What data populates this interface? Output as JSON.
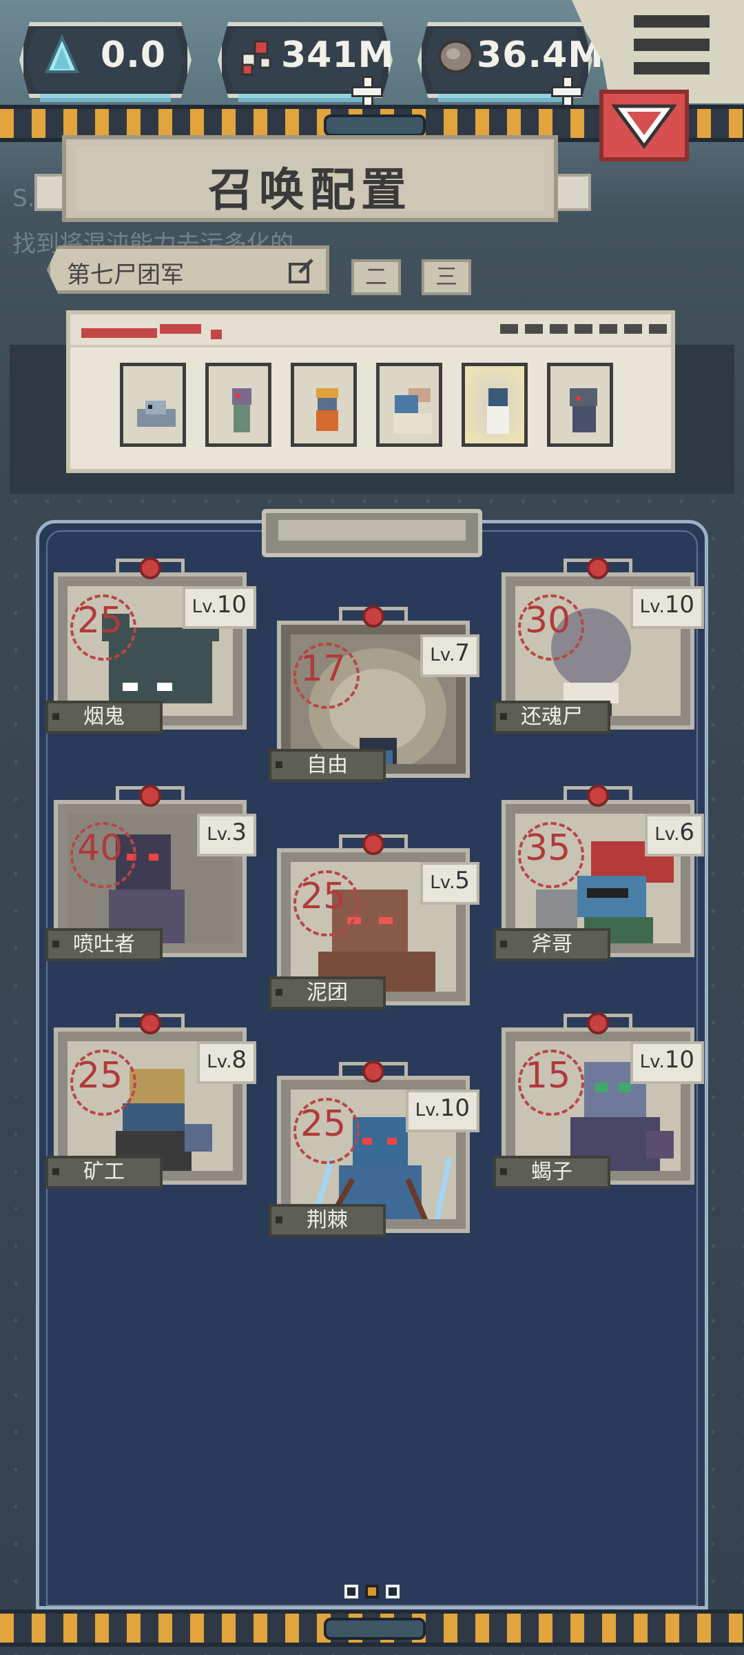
{
  "resources": [
    {
      "id": "crystal",
      "value": "0.0",
      "icon": "crystal-icon",
      "has_plus": false
    },
    {
      "id": "gems",
      "value": "341M",
      "icon": "blood-gem-icon",
      "has_plus": true
    },
    {
      "id": "skulls",
      "value": "36.4M",
      "icon": "skull-coin-icon",
      "has_plus": true
    }
  ],
  "header": {
    "title": "召唤配置",
    "bg_text_left": "S.O",
    "bg_text_hint": "找到将混沌能力去污多化的"
  },
  "squad": {
    "name": "第七尸团军",
    "tabs": [
      "二",
      "三"
    ]
  },
  "lineup": {
    "slots": [
      "slot-1",
      "slot-2",
      "slot-3",
      "slot-4",
      "slot-5",
      "slot-6"
    ]
  },
  "cards": [
    {
      "name": "烟鬼",
      "cost": "25",
      "lv_prefix": "Lv.",
      "lv": "10"
    },
    {
      "name": "自由",
      "cost": "17",
      "lv_prefix": "Lv.",
      "lv": "7"
    },
    {
      "name": "还魂尸",
      "cost": "30",
      "lv_prefix": "Lv.",
      "lv": "10"
    },
    {
      "name": "喷吐者",
      "cost": "40",
      "lv_prefix": "Lv.",
      "lv": "3"
    },
    {
      "name": "泥团",
      "cost": "25",
      "lv_prefix": "Lv.",
      "lv": "5"
    },
    {
      "name": "斧哥",
      "cost": "35",
      "lv_prefix": "Lv.",
      "lv": "6"
    },
    {
      "name": "矿工",
      "cost": "25",
      "lv_prefix": "Lv.",
      "lv": "8"
    },
    {
      "name": "荆棘",
      "cost": "25",
      "lv_prefix": "Lv.",
      "lv": "10"
    },
    {
      "name": "蝎子",
      "cost": "15",
      "lv_prefix": "Lv.",
      "lv": "10"
    }
  ],
  "pagination": {
    "total": 3,
    "current": 2
  },
  "colors": {
    "accent_red": "#c94040",
    "hazard_orange": "#e2a43d",
    "panel_blue": "#293a58"
  }
}
